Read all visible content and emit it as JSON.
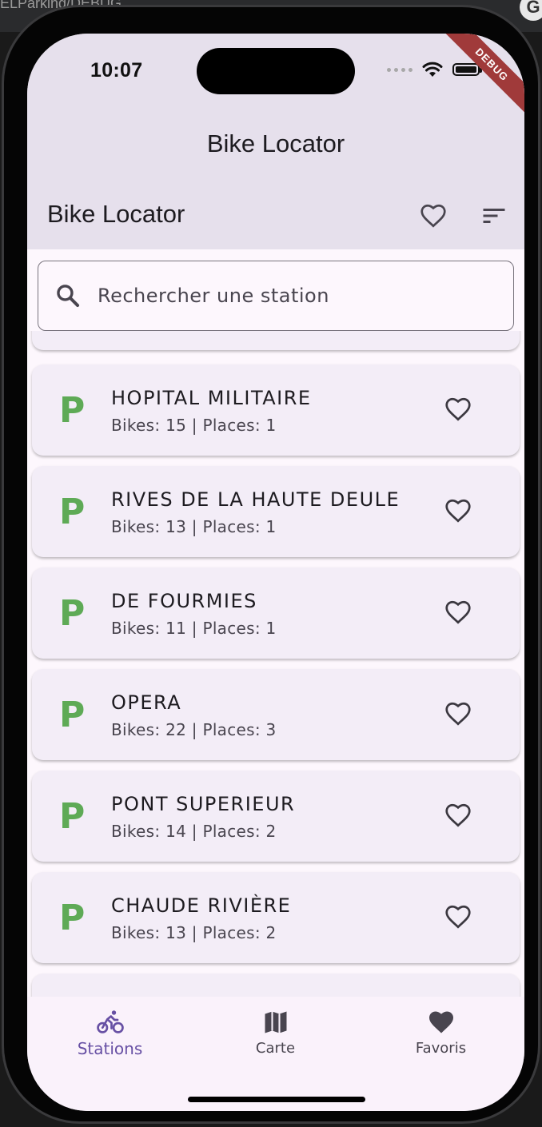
{
  "host": {
    "window_text": "ELParking/DEBUG",
    "account_initial": "G"
  },
  "status_bar": {
    "time": "10:07",
    "debug_banner": "DEBUG",
    "icons": [
      "signal-dots-icon",
      "wifi-icon",
      "battery-icon"
    ]
  },
  "app": {
    "title": "Bike Locator",
    "appbar_title": "Bike Locator",
    "actions": [
      "heart-outline-icon",
      "sort-icon"
    ]
  },
  "search": {
    "placeholder": "Rechercher une station",
    "icon": "search-icon"
  },
  "stations": [
    {
      "name": "HOPITAL MILITAIRE",
      "info": "Bikes: 15 | Places: 1",
      "favorite": false
    },
    {
      "name": "RIVES DE LA HAUTE DEULE",
      "info": "Bikes: 13 | Places: 1",
      "favorite": false
    },
    {
      "name": "DE FOURMIES",
      "info": "Bikes: 11 | Places: 1",
      "favorite": false
    },
    {
      "name": "OPERA",
      "info": "Bikes: 22 | Places: 3",
      "favorite": false
    },
    {
      "name": "PONT SUPERIEUR",
      "info": "Bikes: 14 | Places: 2",
      "favorite": false
    },
    {
      "name": "CHAUDE RIVIÈRE",
      "info": "Bikes: 13 | Places: 2",
      "favorite": false
    }
  ],
  "station_icon_letter": "P",
  "bottom_nav": [
    {
      "label": "Stations",
      "icon": "bike-icon",
      "active": true
    },
    {
      "label": "Carte",
      "icon": "map-icon",
      "active": false
    },
    {
      "label": "Favoris",
      "icon": "heart-filled-icon",
      "active": false
    }
  ],
  "colors": {
    "accent": "#6750a4",
    "parking_green": "#5eaa56",
    "header_bg": "#e6e0ec",
    "card_bg": "#f3edf7"
  }
}
